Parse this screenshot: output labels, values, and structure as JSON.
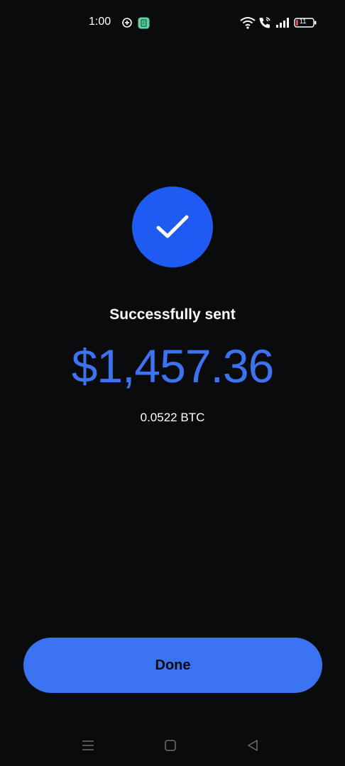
{
  "status_bar": {
    "time": "1:00",
    "battery_level": "11",
    "icons": [
      "location-plus-icon",
      "app-notification-icon",
      "wifi-icon",
      "wifi-calling-icon",
      "signal-icon",
      "battery-icon"
    ]
  },
  "success": {
    "icon": "checkmark-icon",
    "title": "Successfully sent",
    "fiat_amount": "$1,457.36",
    "crypto_amount": "0.0522 BTC"
  },
  "actions": {
    "done_label": "Done"
  },
  "navigation": {
    "icons": [
      "menu-icon",
      "home-icon",
      "back-icon"
    ]
  },
  "colors": {
    "background": "#0a0b0d",
    "accent": "#3b73f2",
    "check_circle": "#1f5bf0",
    "app_icon": "#5fd3a3",
    "battery_low": "#e5484d"
  }
}
